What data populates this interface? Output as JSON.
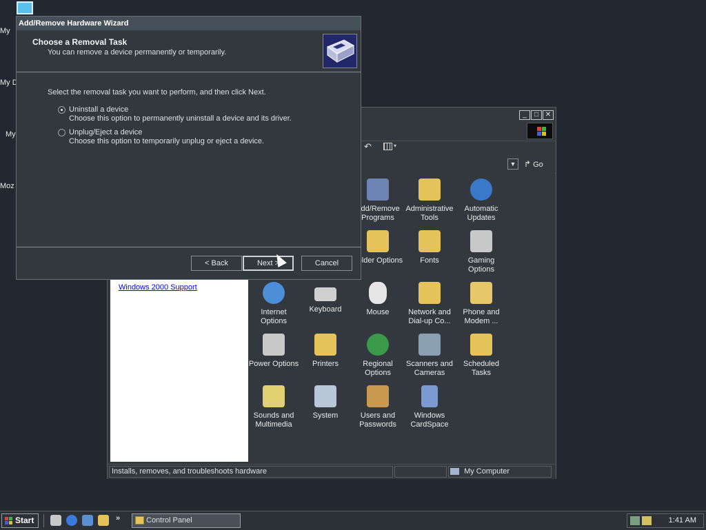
{
  "desktop": {
    "icons": [
      "My",
      "My D",
      "My",
      "Moz"
    ]
  },
  "control_panel": {
    "window_buttons": {
      "minimize": "_",
      "maximize": "□",
      "close": "✕"
    },
    "go_label": "Go",
    "left_pane_link": "Windows 2000 Support",
    "items": [
      {
        "label": "Add/Remove Programs",
        "icon": "add-remove-programs-icon",
        "color": "#6d84b5"
      },
      {
        "label": "Administrative Tools",
        "icon": "admin-tools-folder-icon",
        "color": "#e4c45a"
      },
      {
        "label": "Automatic Updates",
        "icon": "windows-update-globe-icon",
        "color": "#3a78c8"
      },
      {
        "label": "Folder Options",
        "icon": "folder-options-icon",
        "color": "#e4c45a"
      },
      {
        "label": "Fonts",
        "icon": "fonts-folder-icon",
        "color": "#e4c45a"
      },
      {
        "label": "Gaming Options",
        "icon": "joystick-icon",
        "color": "#c8c8c8"
      },
      {
        "label": "Internet Options",
        "icon": "internet-globe-icon",
        "color": "#4c8fd8"
      },
      {
        "label": "Keyboard",
        "icon": "keyboard-icon",
        "color": "#d0d0d0"
      },
      {
        "label": "Mouse",
        "icon": "mouse-icon",
        "color": "#e6e6e6"
      },
      {
        "label": "Network and Dial-up Co...",
        "icon": "network-folder-icon",
        "color": "#e4c45a"
      },
      {
        "label": "Phone and Modem ...",
        "icon": "phone-icon",
        "color": "#e6c86a"
      },
      {
        "label": "Power Options",
        "icon": "power-plug-icon",
        "color": "#c8c8c8"
      },
      {
        "label": "Printers",
        "icon": "printers-folder-icon",
        "color": "#e4c45a"
      },
      {
        "label": "Regional Options",
        "icon": "globe-icon",
        "color": "#3a9a4a"
      },
      {
        "label": "Scanners and Cameras",
        "icon": "scanner-icon",
        "color": "#8aa0b0"
      },
      {
        "label": "Scheduled Tasks",
        "icon": "scheduled-tasks-folder-icon",
        "color": "#e4c45a"
      },
      {
        "label": "Sounds and Multimedia",
        "icon": "speaker-icon",
        "color": "#e0d070"
      },
      {
        "label": "System",
        "icon": "computer-icon",
        "color": "#b8c8d8"
      },
      {
        "label": "Users and Passwords",
        "icon": "users-keys-icon",
        "color": "#c89a50"
      },
      {
        "label": "Windows CardSpace",
        "icon": "cardspace-icon",
        "color": "#7a9ad0"
      }
    ],
    "status": {
      "description": "Installs, removes, and troubleshoots hardware",
      "zone": "My Computer"
    }
  },
  "wizard": {
    "title": "Add/Remove Hardware Wizard",
    "heading": "Choose a Removal Task",
    "subheading": "You can remove a device permanently or temporarily.",
    "instruction": "Select the removal task you want to perform, and then click Next.",
    "options": [
      {
        "label": "Uninstall a device",
        "description": "Choose this option to permanently uninstall a device and its driver.",
        "selected": true
      },
      {
        "label": "Unplug/Eject a device",
        "description": "Choose this option to temporarily unplug or eject a device.",
        "selected": false
      }
    ],
    "buttons": {
      "back": "< Back",
      "next": "Next >",
      "cancel": "Cancel"
    }
  },
  "taskbar": {
    "start_label": "Start",
    "task_label": "Control Panel",
    "clock": "1:41 AM"
  }
}
